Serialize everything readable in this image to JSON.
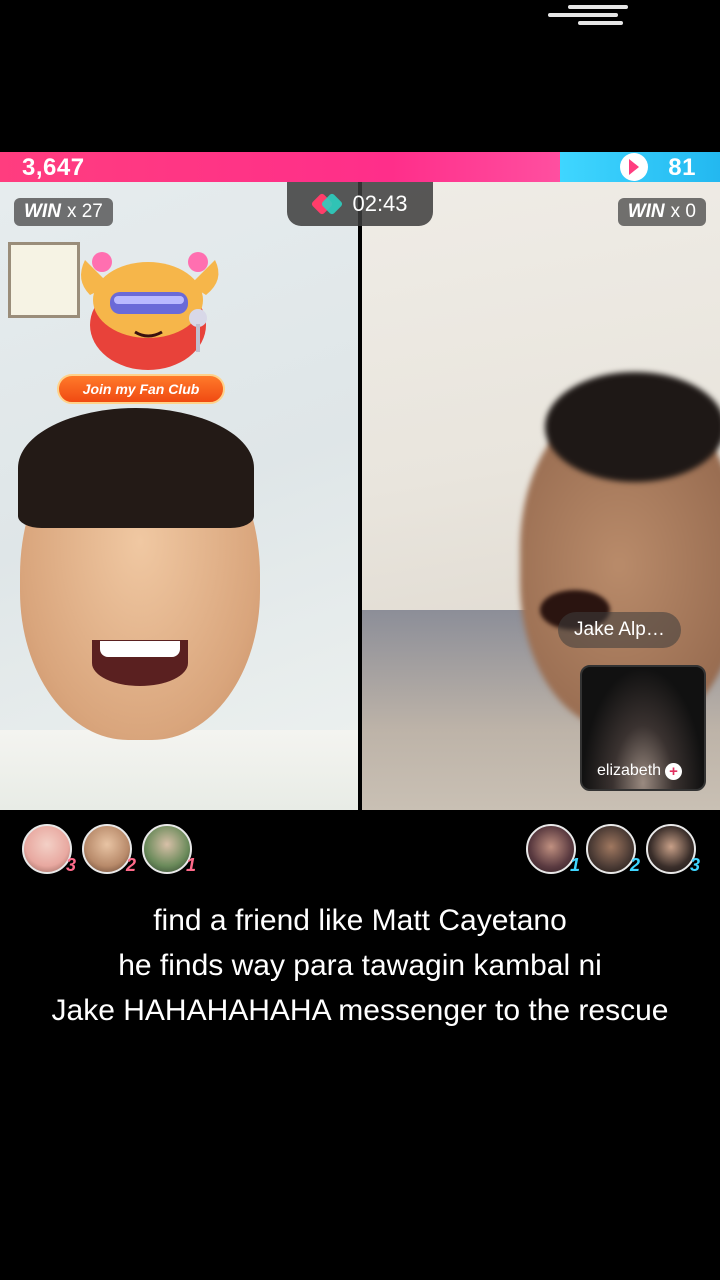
{
  "battle": {
    "left_score": "3,647",
    "right_score": "81",
    "timer": "02:43",
    "left_win_label": "WIN",
    "left_win_count": "x 27",
    "right_win_label": "WIN",
    "right_win_count": "x 0",
    "left_bar_color": "#ff2e8a",
    "right_bar_color": "#2bc2f5"
  },
  "left_host": {
    "fan_club_button": "Join my Fan Club"
  },
  "right_host": {
    "name": "Jake Alp…",
    "guest_name": "elizabeth"
  },
  "left_supporters": [
    {
      "rank": "3",
      "color": "#e8a8a0"
    },
    {
      "rank": "2",
      "color": "#b88a6a"
    },
    {
      "rank": "1",
      "color": "#6a8a5a"
    }
  ],
  "right_supporters": [
    {
      "rank": "1",
      "color": "#5a3a40"
    },
    {
      "rank": "2",
      "color": "#4a3a34"
    },
    {
      "rank": "3",
      "color": "#3a2e2a"
    }
  ],
  "caption": {
    "line1": "find a friend like Matt Cayetano",
    "line2": "he finds way para tawagin kambal ni",
    "line3": "Jake HAHAHAHAHA messenger to the rescue"
  }
}
